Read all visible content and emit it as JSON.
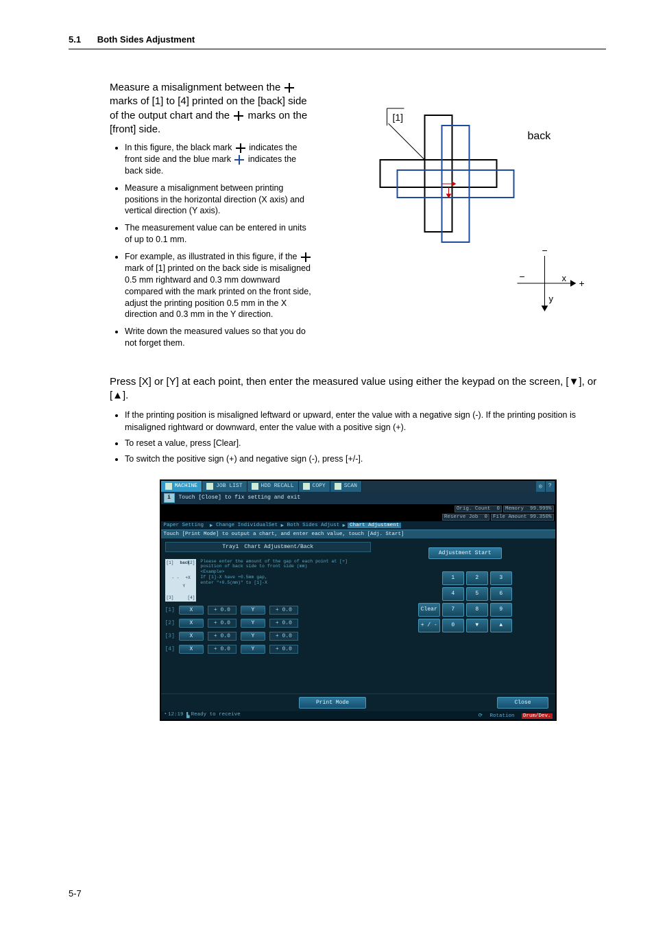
{
  "header": {
    "section_num": "5.1",
    "title": "Both Sides Adjustment"
  },
  "intro": "Measure a misalignment between the  +  marks of [1] to [4] printed on the [back] side of the output chart and the  +  marks on the [front] side.",
  "bullets": [
    "In this figure, the black mark + indicates the front side and the blue mark + indicates the back side.",
    "Measure a misalignment between printing positions in the horizontal direction (X axis) and vertical direction (Y axis).",
    "The measurement value can be entered in units of up to 0.1 mm.",
    "For example, as illustrated in this figure, if the + mark of [1] printed on the back side is misaligned 0.5 mm rightward and 0.3 mm downward compared with the mark printed on the front side, adjust the printing position 0.5 mm in the X direction and 0.3 mm in the Y direction.",
    "Write down the measured values so that you do not forget them."
  ],
  "figure": {
    "corner_label": "[1]",
    "back_label": "back",
    "x_label": "x",
    "y_label": "y"
  },
  "press_line": "Press [X] or [Y] at each point, then enter the measured value using either the keypad on the screen, [▼], or [▲].",
  "bullets2": [
    "If the printing position is misaligned leftward or upward, enter the value with a negative sign (-). If the printing position is misaligned rightward or downward, enter the value with a positive sign (+).",
    "To reset a value, press [Clear].",
    "To switch the positive sign (+) and negative sign (-), press [+/-]."
  ],
  "screenshot": {
    "tabs": {
      "machine": "MACHINE",
      "joblist": "JOB LIST",
      "hdd": "HDD RECALL",
      "copy": "COPY",
      "scan": "SCAN"
    },
    "message": "Touch [Close] to fix setting and exit",
    "stats": {
      "orig_count_label": "Orig. Count",
      "orig_count_val": "0",
      "memory_label": "Memory",
      "memory_val": "99.999%",
      "reserve_label": "Reserve Job",
      "reserve_val": "0",
      "file_label": "File Amount",
      "file_val": "99.350%"
    },
    "breadcrumb": [
      "Paper Setting",
      "▶",
      "Change IndividualSet",
      "▶",
      "Both Sides Adjust",
      "▶",
      "Chart Adjustment"
    ],
    "subbar": "Touch [Print Mode] to output a chart, and enter each value, touch [Adj. Start]",
    "titlebar": {
      "left": "Tray1",
      "right": "Chart Adjustment/Back"
    },
    "guide": "Please enter the amount of the gap of each point at [+] position of back side to front side (mm)\n<Example>\nIf [1]-X have +0.5mm gap,\nenter \"+0.5(mm)\" to [1]-X",
    "minibox": {
      "p1": "[1]",
      "p2": "[2]",
      "p3": "[3]",
      "p4": "[4]",
      "back": "back",
      "plusx": "+X",
      "y": "Y"
    },
    "rows": [
      {
        "pt": "[1]",
        "x": "X",
        "xv": "+ 0.0",
        "y": "Y",
        "yv": "+ 0.0"
      },
      {
        "pt": "[2]",
        "x": "X",
        "xv": "+ 0.0",
        "y": "Y",
        "yv": "+ 0.0"
      },
      {
        "pt": "[3]",
        "x": "X",
        "xv": "+ 0.0",
        "y": "Y",
        "yv": "+ 0.0"
      },
      {
        "pt": "[4]",
        "x": "X",
        "xv": "+ 0.0",
        "y": "Y",
        "yv": "+ 0.0"
      }
    ],
    "adjstart": "Adjustment Start",
    "keypad": {
      "k1": "1",
      "k2": "2",
      "k3": "3",
      "k4": "4",
      "k5": "5",
      "k6": "6",
      "k7": "7",
      "k8": "8",
      "k9": "9",
      "k0": "0",
      "clear": "Clear",
      "pm": "+ / -",
      "down": "▼",
      "up": "▲"
    },
    "print_mode": "Print Mode",
    "close": "Close",
    "bottom": {
      "time": "12:19",
      "status": "Ready to receive",
      "rotation": "Rotation",
      "drum": "Drum/Dev."
    }
  },
  "page_num": "5-7"
}
